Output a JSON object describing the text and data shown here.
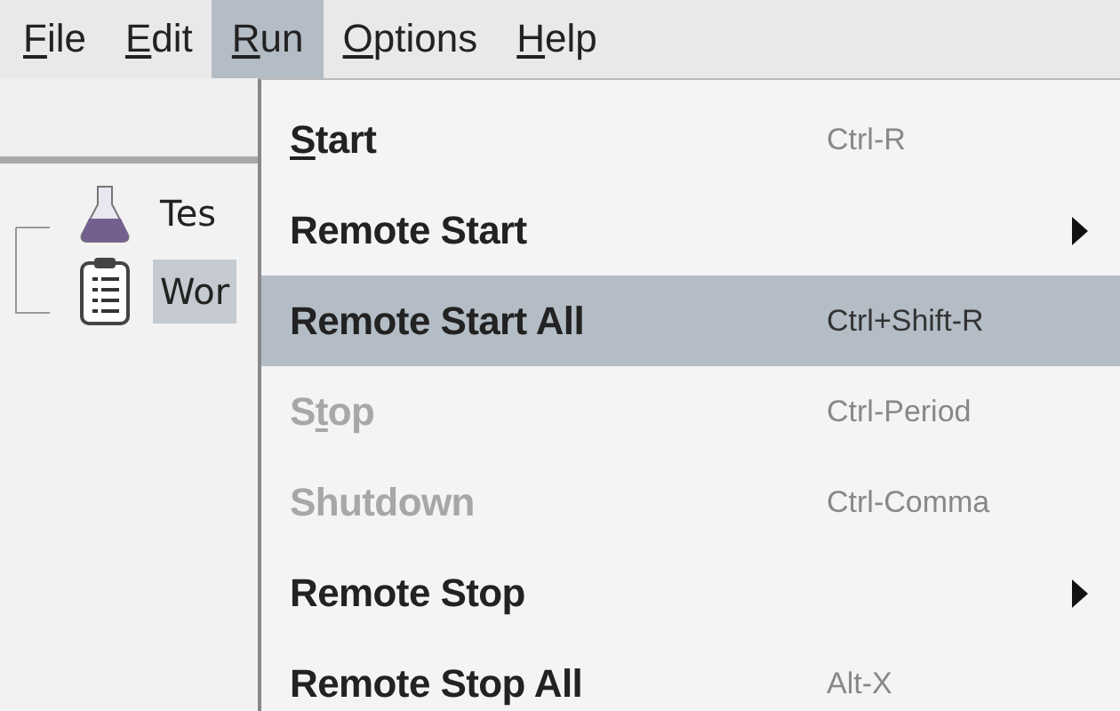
{
  "menu_bar": [
    {
      "label": {
        "key": "F",
        "post": "ile"
      },
      "selected": false
    },
    {
      "label": {
        "key": "E",
        "post": "dit"
      },
      "selected": false
    },
    {
      "label": {
        "key": "R",
        "post": "un"
      },
      "selected": true
    },
    {
      "label": {
        "key": "O",
        "post": "ptions"
      },
      "selected": false
    },
    {
      "label": {
        "key": "H",
        "post": "elp"
      },
      "selected": false
    }
  ],
  "tree": {
    "items": [
      {
        "label": "Tes",
        "kind": "test-plan",
        "selected": false
      },
      {
        "label": "Wor",
        "kind": "workbench",
        "selected": true
      }
    ]
  },
  "run_menu": [
    {
      "label": {
        "key": "S",
        "post": "tart"
      },
      "shortcut": "Ctrl-R",
      "submenu": false,
      "disabled": false,
      "selected": false
    },
    {
      "label": {
        "pre": "Remote Start"
      },
      "submenu": true,
      "disabled": false,
      "selected": false
    },
    {
      "label": {
        "pre": "Remote Start All"
      },
      "shortcut": "Ctrl+Shift-R",
      "submenu": false,
      "disabled": false,
      "selected": true
    },
    {
      "label": {
        "pre": "S",
        "key": "t",
        "post": "op"
      },
      "shortcut": "Ctrl-Period",
      "submenu": false,
      "disabled": true,
      "selected": false
    },
    {
      "label": {
        "pre": "Shutdown"
      },
      "shortcut": "Ctrl-Comma",
      "submenu": false,
      "disabled": true,
      "selected": false
    },
    {
      "label": {
        "pre": "Remote Stop"
      },
      "submenu": true,
      "disabled": false,
      "selected": false
    },
    {
      "label": {
        "pre": "Remote Stop All"
      },
      "shortcut": "Alt-X",
      "submenu": false,
      "disabled": false,
      "selected": false
    }
  ]
}
